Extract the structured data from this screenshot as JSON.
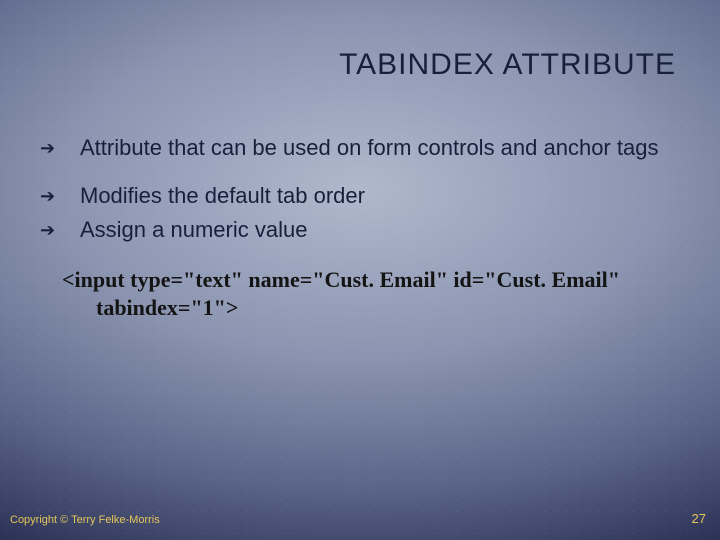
{
  "title": "TABINDEX ATTRIBUTE",
  "bullets": [
    "Attribute that can be used on form controls and anchor tags",
    "Modifies the default tab order",
    "Assign a numeric value"
  ],
  "code_line1": "<input  type=\"text\" name=\"Cust. Email\" id=\"Cust. Email\"",
  "code_line2": "tabindex=\"1\">",
  "footer_left": "Copyright © Terry Felke-Morris",
  "footer_right": "27"
}
